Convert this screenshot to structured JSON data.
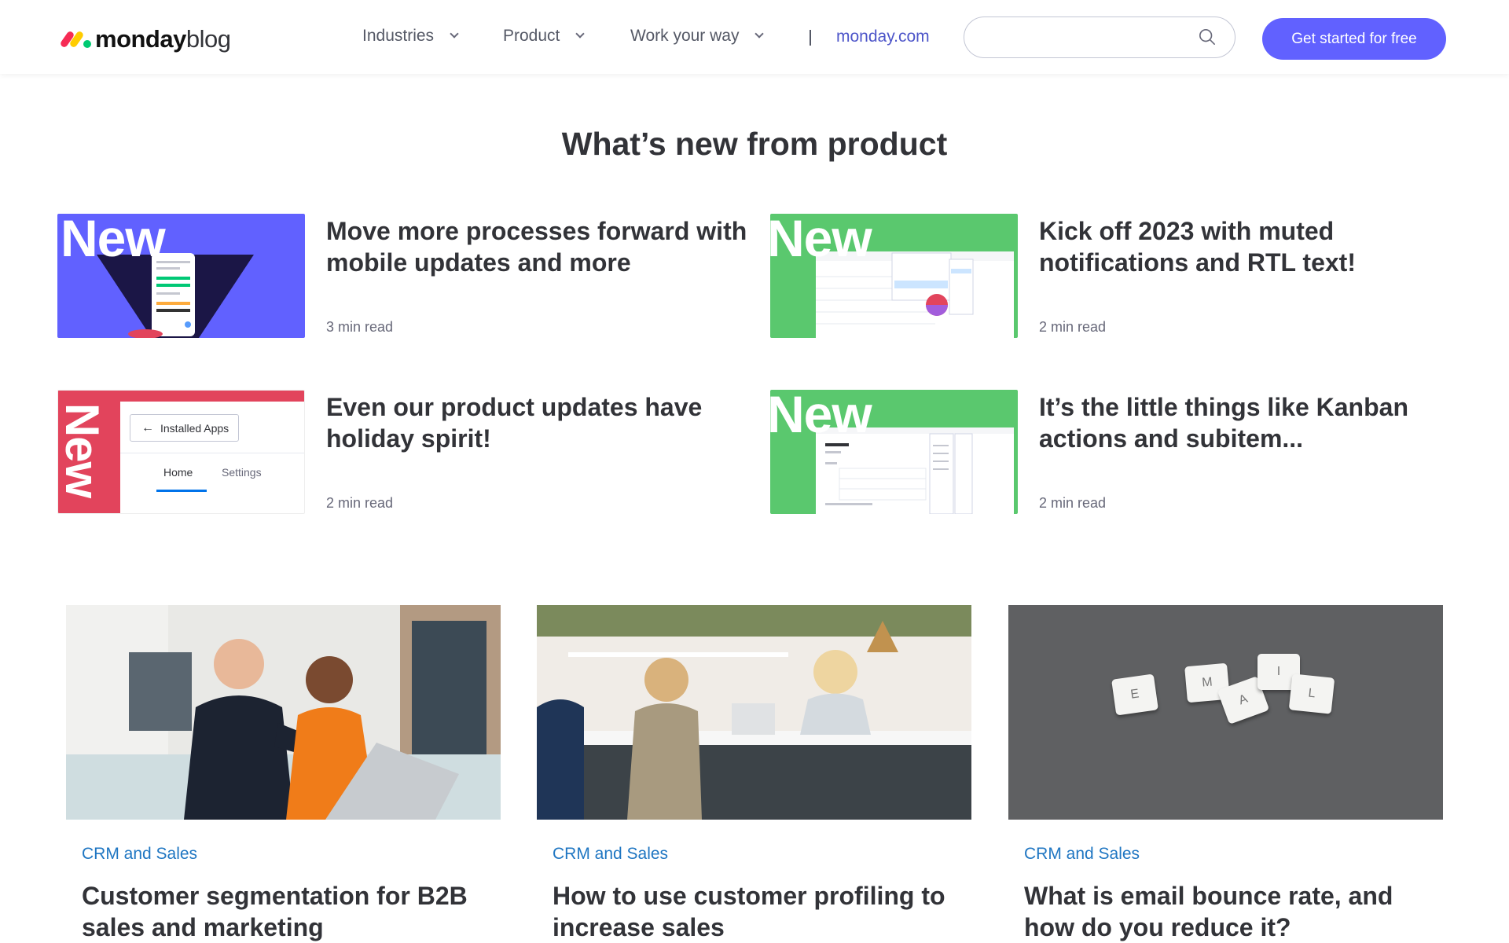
{
  "header": {
    "logo_bold": "monday",
    "logo_light": "blog",
    "nav": [
      {
        "label": "Industries"
      },
      {
        "label": "Product"
      },
      {
        "label": "Work your way"
      }
    ],
    "site_link": "monday.com",
    "search_placeholder": "",
    "cta_label": "Get started for free"
  },
  "section_title": "What’s new from product",
  "product_cards": [
    {
      "title": "Move more processes forward with mobile updates and more",
      "read_time": "3 min read",
      "thumb_text": "New",
      "thumb_color": "#6161ff"
    },
    {
      "title": "Kick off 2023 with muted notifications and RTL text!",
      "read_time": "2 min read",
      "thumb_text": "New",
      "thumb_color": "#5ac86e"
    },
    {
      "title": "Even our product updates have holiday spirit!",
      "read_time": "2 min read",
      "thumb_text": "New",
      "thumb_color": "#e2445c",
      "thumb_button": "Installed Apps",
      "thumb_tabs": [
        "Home",
        "Settings"
      ]
    },
    {
      "title": "It’s the little things like Kanban actions and subitem...",
      "read_time": "2 min read",
      "thumb_text": "New",
      "thumb_color": "#5ac86e"
    }
  ],
  "blog_cards": [
    {
      "category": "CRM and Sales",
      "title": "Customer segmentation for B2B sales and marketing",
      "image": "two-men-at-laptop-photo"
    },
    {
      "category": "CRM and Sales",
      "title": "How to use customer profiling to increase sales",
      "image": "shop-counter-photo"
    },
    {
      "category": "CRM and Sales",
      "title": "What is email bounce rate, and how do you reduce it?",
      "image": "email-letter-tiles-photo",
      "tiles": [
        "E",
        "M",
        "A",
        "I",
        "L"
      ]
    }
  ],
  "colors": {
    "accent": "#6161ff",
    "link": "#4d55c9",
    "category": "#1f76c2",
    "text": "#323338"
  }
}
